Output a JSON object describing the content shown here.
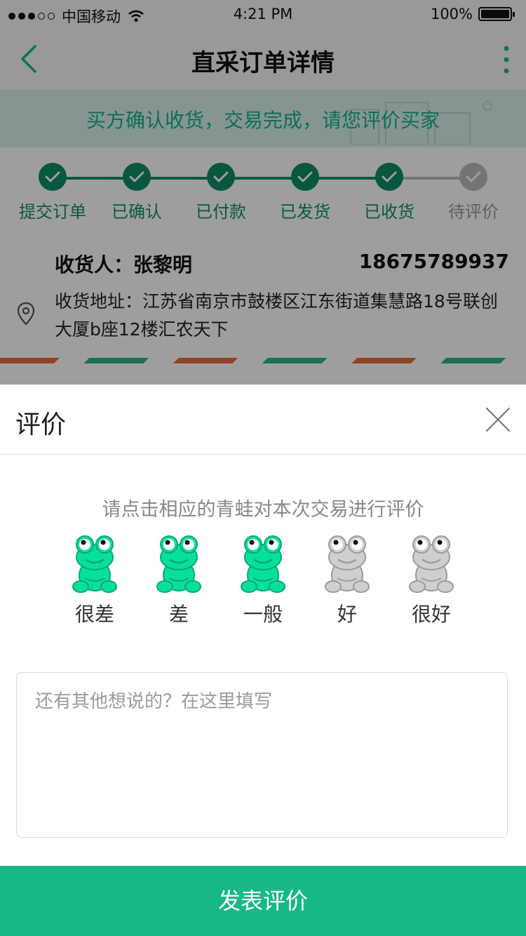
{
  "statusbar": {
    "carrier": "中国移动",
    "time": "4:21 PM",
    "battery": "100%"
  },
  "nav": {
    "title": "直采订单详情"
  },
  "banner": {
    "message": "买方确认收货，交易完成，请您评价买家"
  },
  "steps": [
    {
      "label": "提交订单",
      "done": true
    },
    {
      "label": "已确认",
      "done": true
    },
    {
      "label": "已付款",
      "done": true
    },
    {
      "label": "已发货",
      "done": true
    },
    {
      "label": "已收货",
      "done": true
    },
    {
      "label": "待评价",
      "done": false
    }
  ],
  "address": {
    "name": "收货人：张黎明",
    "phone": "18675789937",
    "detail": "收货地址：江苏省南京市鼓楼区江东街道集慧路18号联创大厦b座12楼汇农天下"
  },
  "review": {
    "title": "评价",
    "prompt": "请点击相应的青蛙对本次交易进行评价",
    "rating": 3,
    "options": [
      "很差",
      "差",
      "一般",
      "好",
      "很好"
    ],
    "placeholder": "还有其他想说的？在这里填写",
    "submit_label": "发表评价"
  },
  "colors": {
    "accent": "#16b886",
    "frog_active": "#07e09b",
    "frog_inactive": "#cfcfcf"
  }
}
